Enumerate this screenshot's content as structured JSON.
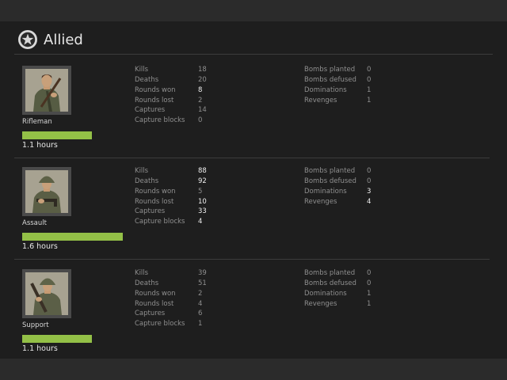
{
  "team": {
    "name": "Allied",
    "icon": "star-emblem-icon"
  },
  "colors": {
    "bar": "#93c047",
    "panel": "#1e1e1e",
    "label": "#8f8f8f",
    "highlight": "#f0f0f0"
  },
  "classes": [
    {
      "name": "Rifleman",
      "hours": "1.1 hours",
      "hours_fraction": 0.69,
      "weapon": "rifle",
      "stats_left": [
        {
          "label": "Kills",
          "value": "18",
          "hi": false
        },
        {
          "label": "Deaths",
          "value": "20",
          "hi": false
        },
        {
          "label": "Rounds won",
          "value": "8",
          "hi": true
        },
        {
          "label": "Rounds lost",
          "value": "2",
          "hi": false
        },
        {
          "label": "Captures",
          "value": "14",
          "hi": false
        },
        {
          "label": "Capture blocks",
          "value": "0",
          "hi": false
        }
      ],
      "stats_right": [
        {
          "label": "Bombs planted",
          "value": "0",
          "hi": false
        },
        {
          "label": "Bombs defused",
          "value": "0",
          "hi": false
        },
        {
          "label": "Dominations",
          "value": "1",
          "hi": false
        },
        {
          "label": "Revenges",
          "value": "1",
          "hi": false
        }
      ]
    },
    {
      "name": "Assault",
      "hours": "1.6 hours",
      "hours_fraction": 1.0,
      "weapon": "smg",
      "stats_left": [
        {
          "label": "Kills",
          "value": "88",
          "hi": true
        },
        {
          "label": "Deaths",
          "value": "92",
          "hi": true
        },
        {
          "label": "Rounds won",
          "value": "5",
          "hi": false
        },
        {
          "label": "Rounds lost",
          "value": "10",
          "hi": true
        },
        {
          "label": "Captures",
          "value": "33",
          "hi": true
        },
        {
          "label": "Capture blocks",
          "value": "4",
          "hi": true
        }
      ],
      "stats_right": [
        {
          "label": "Bombs planted",
          "value": "0",
          "hi": false
        },
        {
          "label": "Bombs defused",
          "value": "0",
          "hi": false
        },
        {
          "label": "Dominations",
          "value": "3",
          "hi": true
        },
        {
          "label": "Revenges",
          "value": "4",
          "hi": true
        }
      ]
    },
    {
      "name": "Support",
      "hours": "1.1 hours",
      "hours_fraction": 0.69,
      "weapon": "bar",
      "stats_left": [
        {
          "label": "Kills",
          "value": "39",
          "hi": false
        },
        {
          "label": "Deaths",
          "value": "51",
          "hi": false
        },
        {
          "label": "Rounds won",
          "value": "2",
          "hi": false
        },
        {
          "label": "Rounds lost",
          "value": "4",
          "hi": false
        },
        {
          "label": "Captures",
          "value": "6",
          "hi": false
        },
        {
          "label": "Capture blocks",
          "value": "1",
          "hi": false
        }
      ],
      "stats_right": [
        {
          "label": "Bombs planted",
          "value": "0",
          "hi": false
        },
        {
          "label": "Bombs defused",
          "value": "0",
          "hi": false
        },
        {
          "label": "Dominations",
          "value": "1",
          "hi": false
        },
        {
          "label": "Revenges",
          "value": "1",
          "hi": false
        }
      ]
    }
  ]
}
